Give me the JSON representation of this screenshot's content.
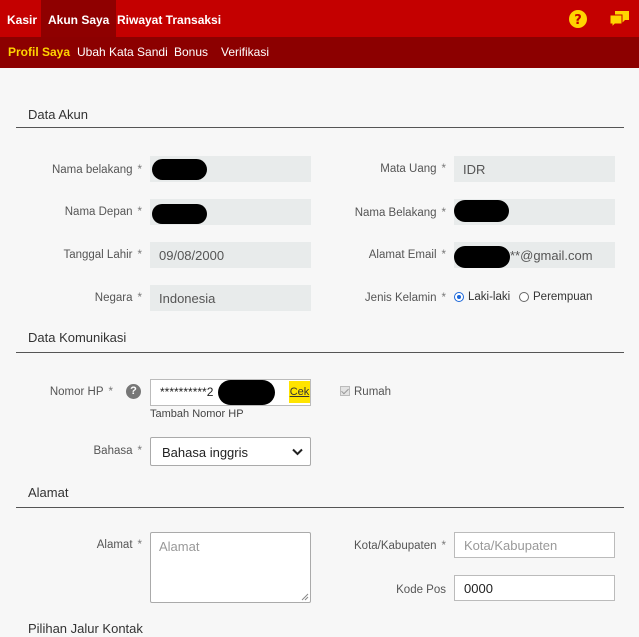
{
  "topnav": {
    "tabs": [
      {
        "label": "Kasir"
      },
      {
        "label": "Akun Saya"
      },
      {
        "label": "Riwayat Transaksi"
      }
    ],
    "icons": [
      "help-icon",
      "chat-icon"
    ]
  },
  "subnav": {
    "tabs": [
      {
        "label": "Profil Saya"
      },
      {
        "label": "Ubah Kata Sandi"
      },
      {
        "label": "Bonus"
      },
      {
        "label": "Verifikasi"
      }
    ]
  },
  "colors": {
    "primary": "#c40000",
    "secondary": "#8c0000",
    "accent": "#ffd400"
  },
  "account": {
    "title": "Data Akun",
    "required_mark": "*",
    "last_name_label": "Nama belakang",
    "first_name_label": "Nama Depan",
    "birthdate_label": "Tanggal Lahir",
    "birthdate_value": "09/08/2000",
    "country_label": "Negara",
    "country_value": "Indonesia",
    "currency_label": "Mata Uang",
    "currency_value": "IDR",
    "last_name2_label": "Nama Belakang",
    "email_label": "Alamat Email",
    "email_value": "**@gmail.com",
    "gender_label": "Jenis Kelamin",
    "gender_options": [
      "Laki-laki",
      "Perempuan"
    ],
    "gender_selected": "Laki-laki"
  },
  "communication": {
    "title": "Data Komunikasi",
    "phone_label": "Nomor HP",
    "phone_value": "**********2",
    "check_label": "Cek",
    "add_phone": "Tambah Nomor HP",
    "home_label": "Rumah",
    "language_label": "Bahasa",
    "language_value": "Bahasa inggris"
  },
  "address": {
    "title": "Alamat",
    "address_label": "Alamat",
    "address_placeholder": "Alamat",
    "city_label": "Kota/Kabupaten",
    "city_placeholder": "Kota/Kabupaten",
    "postal_label": "Kode Pos",
    "postal_value": "0000"
  },
  "contact": {
    "title": "Pilihan Jalur Kontak"
  }
}
